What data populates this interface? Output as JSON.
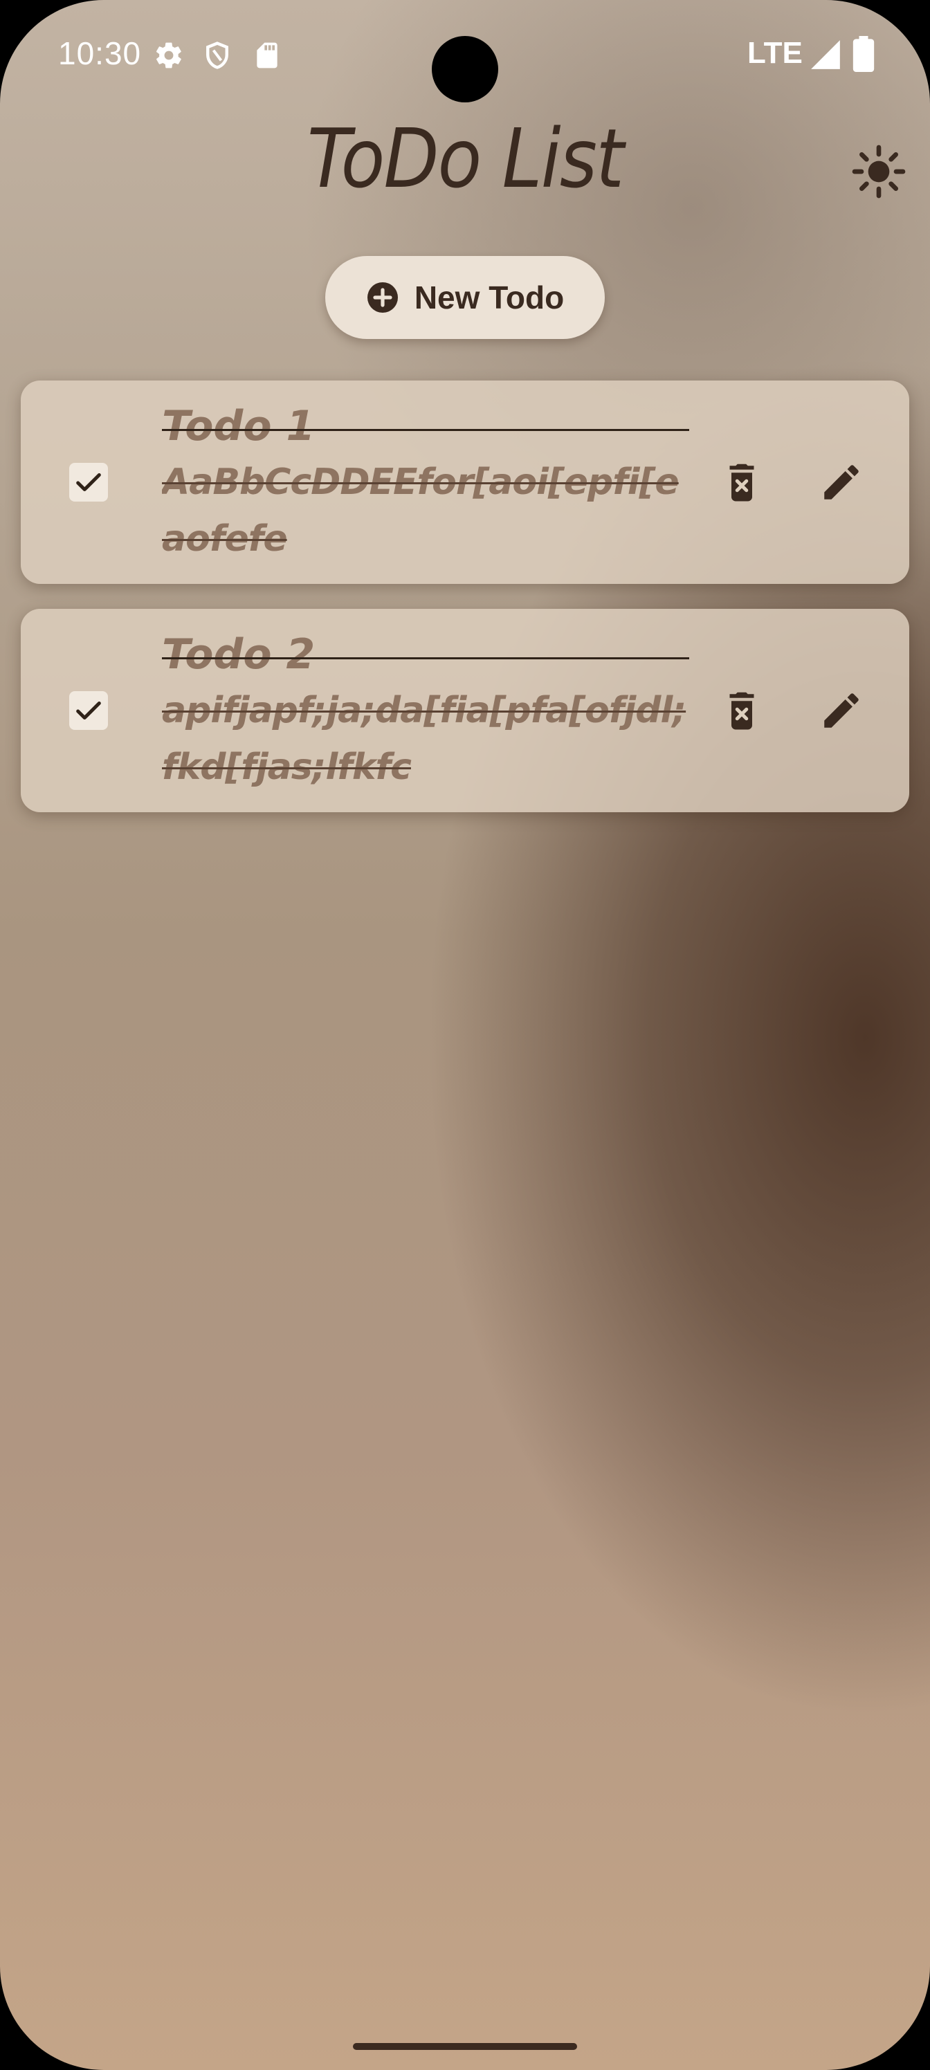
{
  "status_bar": {
    "time": "10:30",
    "network": "LTE",
    "icons": [
      "settings-icon",
      "shield-icon",
      "sd-card-icon",
      "signal-icon",
      "battery-icon"
    ]
  },
  "header": {
    "title": "ToDo List",
    "theme_icon": "sun-icon"
  },
  "actions": {
    "new_todo_label": "New Todo",
    "new_todo_icon": "plus-circle-icon"
  },
  "todos": [
    {
      "title": "Todo 1",
      "body": "AaBbCcDDEEfor[aoi[epfi[eaofefe",
      "completed": true
    },
    {
      "title": "Todo 2",
      "body": "apifjapf;ja;da[fia[pfa[ofjdl;fkd[fjas;lfkfc",
      "completed": true
    }
  ],
  "colors": {
    "text_dark": "#3a2a20",
    "card_bg": "#ded0be",
    "completed_text": "#8e7461",
    "button_bg": "#ece2d6"
  }
}
